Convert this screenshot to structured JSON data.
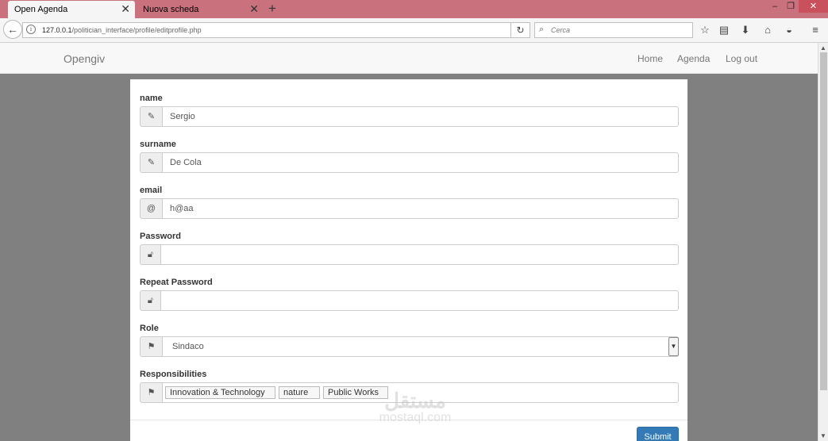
{
  "browser": {
    "tabs": [
      {
        "label": "Open Agenda",
        "active": true
      },
      {
        "label": "Nuova scheda",
        "active": false
      }
    ],
    "url_host": "127.0.0.1",
    "url_path": "/politician_interface/profile/editprofile.php",
    "search_placeholder": "Cerca",
    "icons": {
      "back": "back-arrow-icon",
      "info": "info-icon",
      "reload": "reload-icon",
      "search": "search-icon",
      "bookmark": "star-icon",
      "reading_list": "reading-list-icon",
      "download": "download-icon",
      "home": "home-icon",
      "pocket": "pocket-icon",
      "menu": "hamburger-menu-icon"
    }
  },
  "site": {
    "brand": "Opengiv",
    "nav": {
      "home": "Home",
      "agenda": "Agenda",
      "logout": "Log out"
    }
  },
  "form": {
    "name": {
      "label": "name",
      "value": "Sergio",
      "icon": "pencil-icon"
    },
    "surname": {
      "label": "surname",
      "value": "De Cola",
      "icon": "pencil-icon"
    },
    "email": {
      "label": "email",
      "value": "h@aa",
      "icon": "at-icon"
    },
    "password": {
      "label": "Password",
      "value": "",
      "icon": "lock-icon"
    },
    "repeat_password": {
      "label": "Repeat Password",
      "value": "",
      "icon": "lock-icon"
    },
    "role": {
      "label": "Role",
      "value": "Sindaco",
      "icon": "flag-icon"
    },
    "responsibilities": {
      "label": "Responsibilities",
      "icon": "flag-icon",
      "tags": [
        "Innovation & Technology",
        "nature",
        "Public Works"
      ]
    },
    "submit_label": "Submit"
  },
  "watermark": {
    "line1": "مستقل",
    "line2": "mostaql.com"
  },
  "colors": {
    "tabbar": "#c9727e",
    "primary_button": "#337ab7",
    "page_bg": "#808080"
  }
}
